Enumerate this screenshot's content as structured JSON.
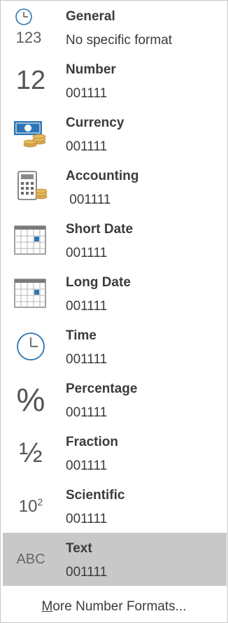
{
  "items": [
    {
      "title": "General",
      "sample": "No specific format",
      "icon": "clock-123-icon"
    },
    {
      "title": "Number",
      "sample": "001111",
      "icon": "number-12-icon",
      "glyph": "12"
    },
    {
      "title": "Currency",
      "sample": "001111",
      "icon": "currency-banknote-coins-icon"
    },
    {
      "title": "Accounting",
      "sample": " 001111",
      "icon": "accounting-calculator-coins-icon"
    },
    {
      "title": "Short Date",
      "sample": "001111",
      "icon": "calendar-icon"
    },
    {
      "title": "Long Date",
      "sample": "001111",
      "icon": "calendar-icon"
    },
    {
      "title": "Time",
      "sample": "001111",
      "icon": "clock-icon"
    },
    {
      "title": "Percentage",
      "sample": "001111",
      "icon": "percent-icon",
      "glyph": "%"
    },
    {
      "title": "Fraction",
      "sample": "001111",
      "icon": "fraction-half-icon",
      "glyph": "½"
    },
    {
      "title": "Scientific",
      "sample": "001111",
      "icon": "scientific-notation-icon"
    },
    {
      "title": "Text",
      "sample": "001111",
      "icon": "text-abc-icon",
      "glyph": "ABC",
      "selected": true
    }
  ],
  "general_icon_digits": "123",
  "scientific_icon": {
    "base": "10",
    "exponent": "2"
  },
  "footer": {
    "accel_key": "M",
    "label_rest": "ore Number Formats..."
  },
  "colors": {
    "accent_blue": "#2e75b6",
    "coin_gold": "#d6a84a",
    "selected_bg": "#c8c8c8",
    "text": "#3b3b3b",
    "icon_gray": "#5e5e5e"
  }
}
